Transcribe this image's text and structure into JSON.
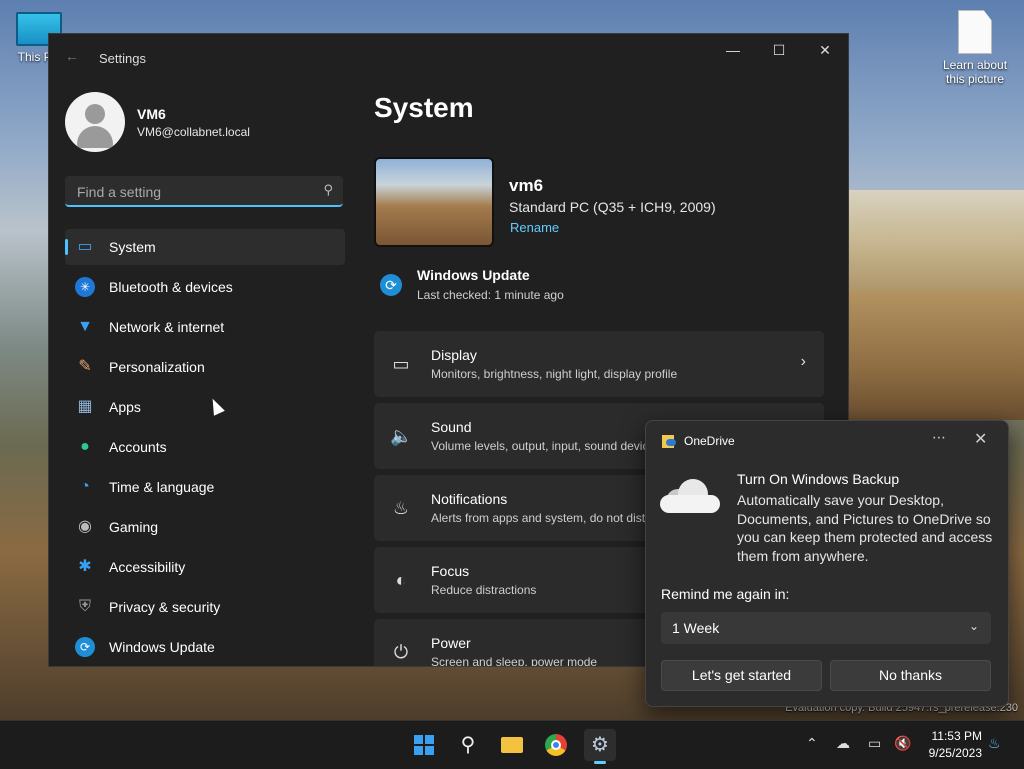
{
  "desktop": {
    "icons": [
      {
        "label": "This PC",
        "icon": "monitor-icon"
      },
      {
        "label": "Learn about\nthis picture",
        "icon": "file-icon"
      }
    ],
    "watermark": "Evaluation copy. Build 25947.rs_prerelease.230"
  },
  "window": {
    "title": "Settings",
    "controls": {
      "minimize": "—",
      "maximize": "☐",
      "close": "✕"
    }
  },
  "user": {
    "name": "VM6",
    "email": "VM6@collabnet.local"
  },
  "search": {
    "placeholder": "Find a setting"
  },
  "nav": {
    "items": [
      {
        "label": "System",
        "icon": "monitor-icon",
        "active": true
      },
      {
        "label": "Bluetooth & devices",
        "icon": "bluetooth-icon"
      },
      {
        "label": "Network & internet",
        "icon": "wifi-icon"
      },
      {
        "label": "Personalization",
        "icon": "brush-icon"
      },
      {
        "label": "Apps",
        "icon": "apps-icon"
      },
      {
        "label": "Accounts",
        "icon": "person-icon"
      },
      {
        "label": "Time & language",
        "icon": "globe-clock-icon"
      },
      {
        "label": "Gaming",
        "icon": "gamepad-icon"
      },
      {
        "label": "Accessibility",
        "icon": "accessibility-icon"
      },
      {
        "label": "Privacy & security",
        "icon": "shield-icon"
      },
      {
        "label": "Windows Update",
        "icon": "sync-icon"
      }
    ]
  },
  "main": {
    "title": "System",
    "device": {
      "name": "vm6",
      "model": "Standard PC (Q35 + ICH9, 2009)",
      "rename": "Rename"
    },
    "update": {
      "title": "Windows Update",
      "status": "Last checked: 1 minute ago"
    },
    "cards": [
      {
        "title": "Display",
        "subtitle": "Monitors, brightness, night light, display profile",
        "icon": "display-icon"
      },
      {
        "title": "Sound",
        "subtitle": "Volume levels, output, input, sound devices",
        "icon": "speaker-icon"
      },
      {
        "title": "Notifications",
        "subtitle": "Alerts from apps and system, do not disturb",
        "icon": "bell-icon"
      },
      {
        "title": "Focus",
        "subtitle": "Reduce distractions",
        "icon": "focus-icon"
      },
      {
        "title": "Power",
        "subtitle": "Screen and sleep, power mode",
        "icon": "power-icon"
      }
    ]
  },
  "toast": {
    "app": "OneDrive",
    "heading": "Turn On Windows Backup",
    "body": "Automatically save your Desktop, Documents, and Pictures to OneDrive so you can keep them protected and access them from anywhere.",
    "remind_label": "Remind me again in:",
    "remind_value": "1 Week",
    "primary": "Let's get started",
    "secondary": "No thanks"
  },
  "taskbar": {
    "time": "11:53 PM",
    "date": "9/25/2023",
    "apps": [
      "start-icon",
      "search-icon",
      "file-explorer-icon",
      "chrome-icon",
      "settings-icon"
    ]
  }
}
